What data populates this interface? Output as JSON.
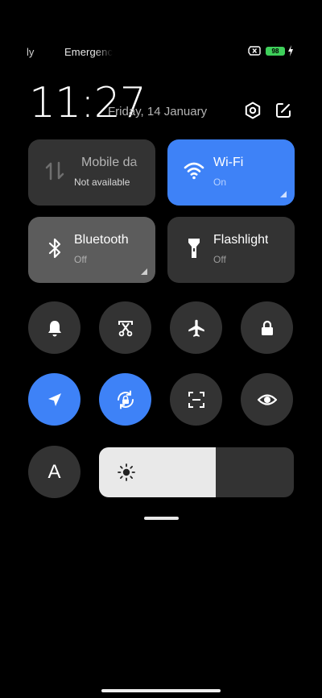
{
  "status_bar": {
    "carrier_1": "ly",
    "carrier_2": "Emergenc",
    "battery_level": "98",
    "icons": [
      "sim-error-icon",
      "battery-icon",
      "charging-icon"
    ]
  },
  "header": {
    "time": "11:27",
    "date": "Friday, 14 January",
    "icons": [
      "settings-icon",
      "edit-icon"
    ]
  },
  "tiles": {
    "mobile_data": {
      "label": "Mobile da",
      "state": "Not available",
      "icon": "mobile-data-arrows-icon"
    },
    "wifi": {
      "label": "Wi-Fi",
      "state": "On",
      "icon": "wifi-icon",
      "active": true
    },
    "bluetooth": {
      "label": "Bluetooth",
      "state": "Off",
      "icon": "bluetooth-icon"
    },
    "flashlight": {
      "label": "Flashlight",
      "state": "Off",
      "icon": "flashlight-icon"
    }
  },
  "toggles": [
    {
      "name": "ring-bell",
      "icon": "bell-icon",
      "active": false
    },
    {
      "name": "screenshot",
      "icon": "scissors-screenshot-icon",
      "active": false
    },
    {
      "name": "airplane-mode",
      "icon": "airplane-icon",
      "active": false
    },
    {
      "name": "lock-screen",
      "icon": "lock-icon",
      "active": false
    },
    {
      "name": "location",
      "icon": "location-arrow-icon",
      "active": true
    },
    {
      "name": "rotation-lock",
      "icon": "rotation-lock-icon",
      "active": true
    },
    {
      "name": "scanner",
      "icon": "scan-icon",
      "active": false
    },
    {
      "name": "reading-mode",
      "icon": "eye-icon",
      "active": false
    },
    {
      "name": "auto-brightness",
      "icon": "auto-brightness-a-icon",
      "active": false
    }
  ],
  "auto_brightness_label": "A",
  "brightness": {
    "level": 0.6,
    "icon": "sun-icon"
  },
  "colors": {
    "accent": "#3e82f7",
    "tile": "#333333",
    "tile_active_gray": "#5c5c5c",
    "battery": "#3ecf5a"
  }
}
